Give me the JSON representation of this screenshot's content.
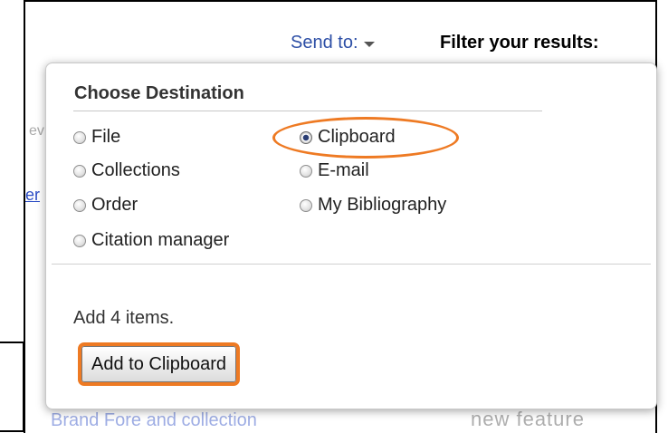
{
  "header": {
    "send_to_label": "Send to:",
    "filter_title": "Filter your results:"
  },
  "background": {
    "fragment_ev": "ev",
    "fragment_link": "er",
    "fragment_bottom": "Brand Fore and collection",
    "fragment_new": "new feature"
  },
  "dropdown": {
    "title": "Choose Destination",
    "options": [
      {
        "label": "File",
        "checked": false
      },
      {
        "label": "Clipboard",
        "checked": true
      },
      {
        "label": "Collections",
        "checked": false
      },
      {
        "label": "E-mail",
        "checked": false
      },
      {
        "label": "Order",
        "checked": false
      },
      {
        "label": "My Bibliography",
        "checked": false
      },
      {
        "label": "Citation manager",
        "checked": false
      }
    ],
    "add_count_text": "Add 4 items.",
    "add_button_label": "Add to Clipboard",
    "highlight_color": "#ee7a23"
  }
}
